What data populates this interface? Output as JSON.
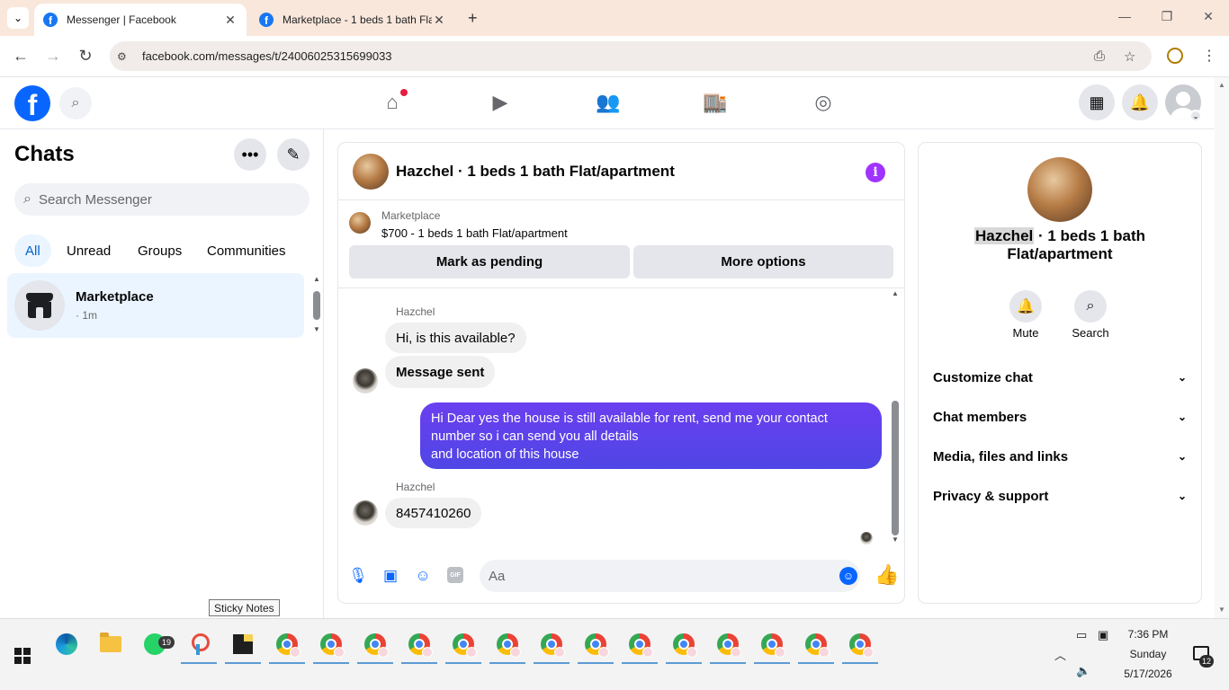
{
  "browser": {
    "tabs": [
      {
        "label": "Messenger | Facebook",
        "active": true
      },
      {
        "label": "Marketplace - 1 beds 1 bath Flat/apartment",
        "active": false
      }
    ],
    "url": "facebook.com/messages/t/24006025315699033"
  },
  "fb": {
    "brand_color": "#0866ff",
    "nav_icons": [
      "home-icon",
      "video-icon",
      "friends-icon",
      "marketplace-icon",
      "groups-icon"
    ],
    "home_has_notification": true
  },
  "sidebar": {
    "title": "Chats",
    "search_placeholder": "Search Messenger",
    "filters": [
      "All",
      "Unread",
      "Groups",
      "Communities"
    ],
    "active_filter": "All",
    "chats": [
      {
        "name": "Marketplace",
        "time": "· 1m"
      }
    ]
  },
  "conversation": {
    "title": "Hazchel · 1 beds 1 bath Flat/apartment",
    "marketplace": {
      "label": "Marketplace",
      "price_line": "$700 - 1 beds 1 bath Flat/apartment",
      "mark_pending": "Mark as pending",
      "more_options": "More options"
    },
    "messages": [
      {
        "sender": "Hazchel",
        "text": "Hi, is this available?"
      },
      {
        "text": "Message sent"
      },
      {
        "outgoing": true,
        "lines": [
          "Hi Dear yes the house is still available for rent, send me your contact",
          "number so i can send you all details",
          "and location of this house"
        ]
      },
      {
        "sender": "Hazchel",
        "text": "8457410260"
      }
    ],
    "composer_placeholder": "Aa",
    "outgoing_color": "#5c3eed"
  },
  "details": {
    "name_highlight": "Hazchel",
    "name_rest": " · 1 beds 1 bath",
    "name_line2": "Flat/apartment",
    "actions": [
      {
        "label": "Mute"
      },
      {
        "label": "Search"
      }
    ],
    "sections": [
      "Customize chat",
      "Chat members",
      "Media, files and links",
      "Privacy & support"
    ]
  },
  "tooltip": "Sticky Notes",
  "taskbar": {
    "whatsapp_badge": "19",
    "time": "7:36 PM",
    "day": "Sunday",
    "date": "5/17/2026",
    "notification_count": "12"
  }
}
